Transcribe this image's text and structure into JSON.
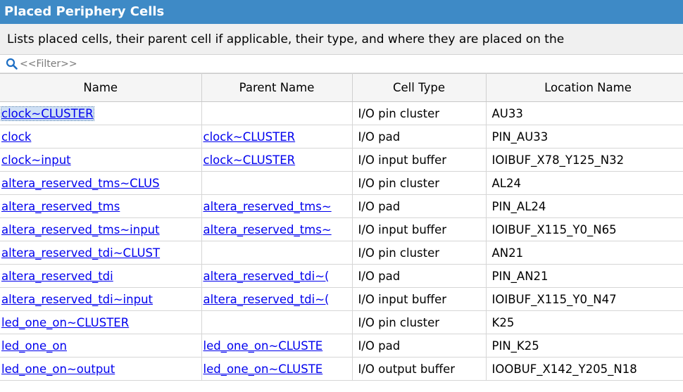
{
  "panel": {
    "title": "Placed Periphery Cells",
    "description": "Lists placed cells, their parent cell if applicable, their type, and where they are placed on the",
    "filter": {
      "placeholder": "<<Filter>>",
      "icon": "search-icon"
    }
  },
  "table": {
    "columns": [
      "Name",
      "Parent Name",
      "Cell Type",
      "Location Name"
    ],
    "rows": [
      {
        "name": "clock~CLUSTER",
        "parent": "",
        "type": "I/O pin cluster",
        "location": "AU33"
      },
      {
        "name": "clock",
        "parent": "clock~CLUSTER",
        "type": "I/O pad",
        "location": "PIN_AU33"
      },
      {
        "name": "clock~input",
        "parent": "clock~CLUSTER",
        "type": "I/O input buffer",
        "location": "IOIBUF_X78_Y125_N32"
      },
      {
        "name": "altera_reserved_tms~CLUS",
        "parent": "",
        "type": "I/O pin cluster",
        "location": "AL24"
      },
      {
        "name": "altera_reserved_tms",
        "parent": "altera_reserved_tms~",
        "type": "I/O pad",
        "location": "PIN_AL24"
      },
      {
        "name": "altera_reserved_tms~input",
        "parent": "altera_reserved_tms~",
        "type": "I/O input buffer",
        "location": "IOIBUF_X115_Y0_N65"
      },
      {
        "name": "altera_reserved_tdi~CLUST",
        "parent": "",
        "type": "I/O pin cluster",
        "location": "AN21"
      },
      {
        "name": "altera_reserved_tdi",
        "parent": "altera_reserved_tdi~(",
        "type": "I/O pad",
        "location": "PIN_AN21"
      },
      {
        "name": "altera_reserved_tdi~input",
        "parent": "altera_reserved_tdi~(",
        "type": "I/O input buffer",
        "location": "IOIBUF_X115_Y0_N47"
      },
      {
        "name": "led_one_on~CLUSTER",
        "parent": "",
        "type": "I/O pin cluster",
        "location": "K25"
      },
      {
        "name": "led_one_on",
        "parent": "led_one_on~CLUSTE",
        "type": "I/O pad",
        "location": "PIN_K25"
      },
      {
        "name": "led_one_on~output",
        "parent": "led_one_on~CLUSTE",
        "type": "I/O output buffer",
        "location": "IOOBUF_X142_Y205_N18"
      }
    ],
    "selected_row": 0
  },
  "colors": {
    "title_bar": "#3e8ac6",
    "link": "#0000ee",
    "header_bg": "#f5f5f5"
  }
}
